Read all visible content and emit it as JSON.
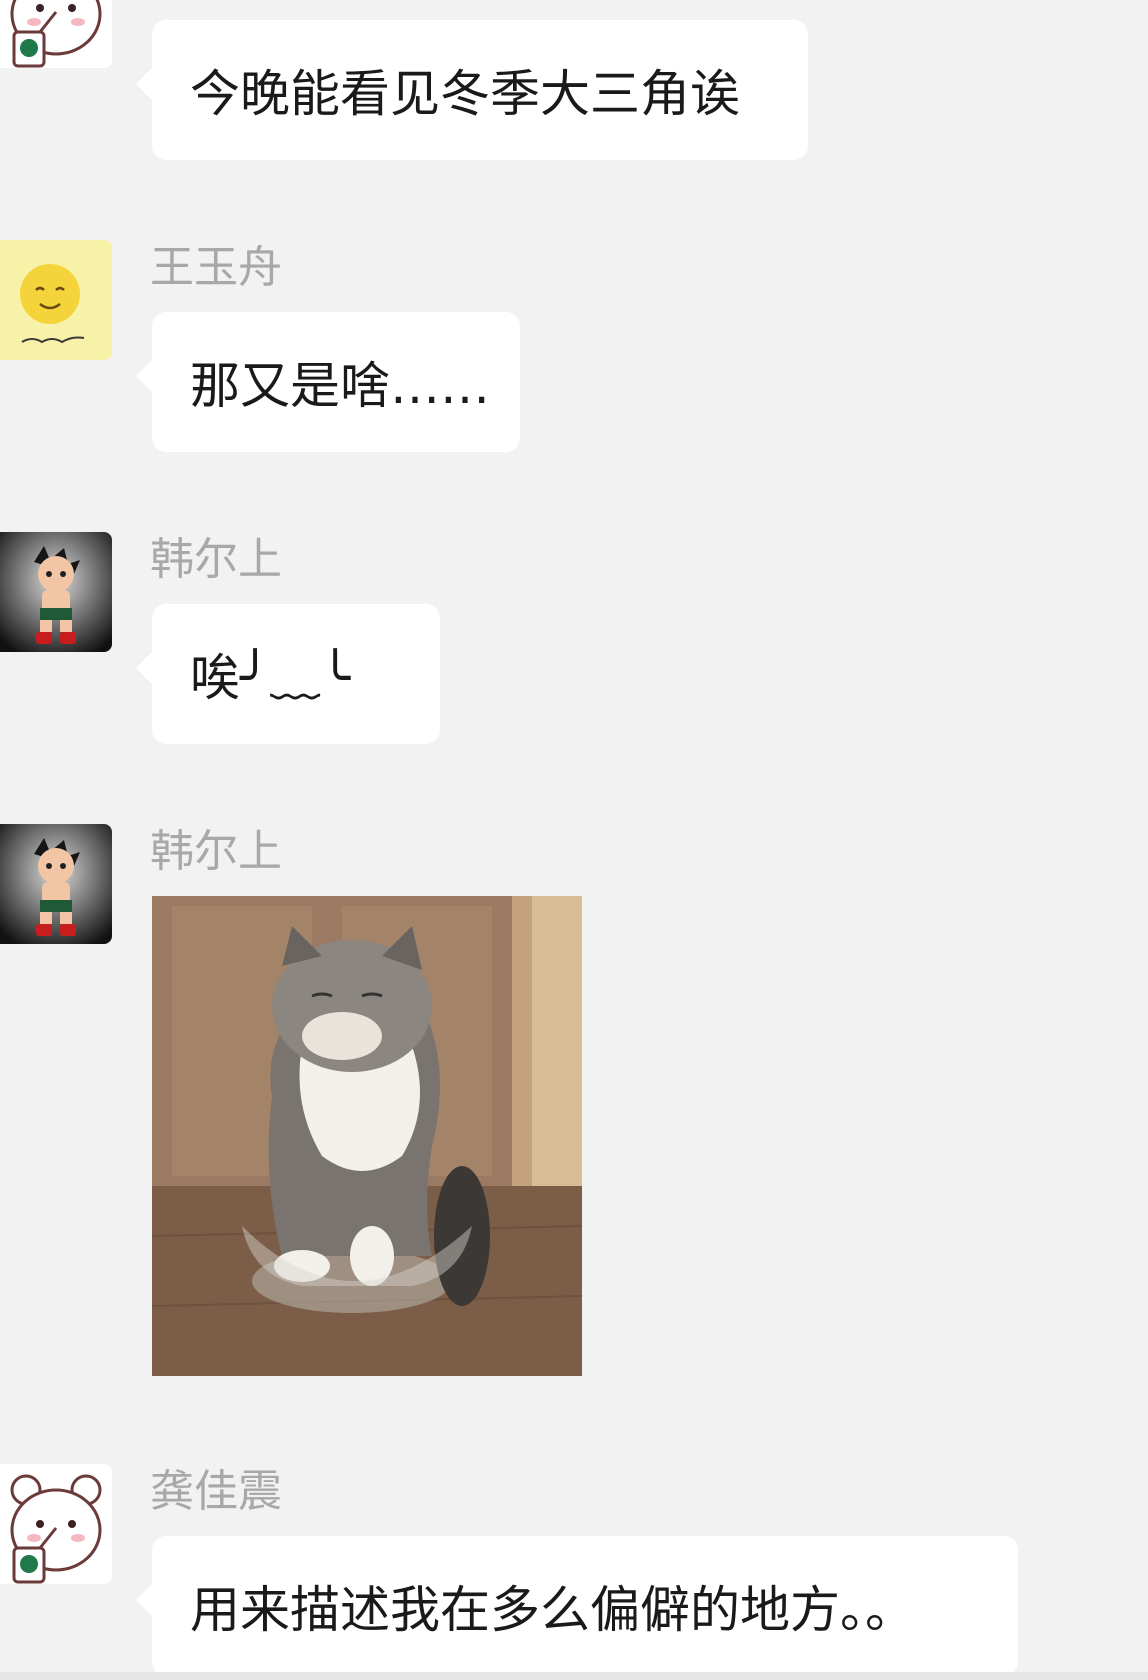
{
  "messages": [
    {
      "sender": "",
      "avatar": "bear-avatar",
      "text": "今晚能看见冬季大三角诶"
    },
    {
      "sender": "王玉舟",
      "avatar": "smiley-avatar",
      "text": "那又是啥……"
    },
    {
      "sender": "韩尔上",
      "avatar": "astro-boy-avatar",
      "text": "唉╯﹏╰"
    },
    {
      "sender": "韩尔上",
      "avatar": "astro-boy-avatar",
      "image": "cat-in-bowl-photo"
    },
    {
      "sender": "龚佳震",
      "avatar": "bear-avatar",
      "text": "用来描述我在多么偏僻的地方。。"
    }
  ],
  "colors": {
    "background": "#f2f2f2",
    "bubble": "#ffffff",
    "sender_name": "#a8a8a8",
    "message_text": "#1a1a1a"
  }
}
